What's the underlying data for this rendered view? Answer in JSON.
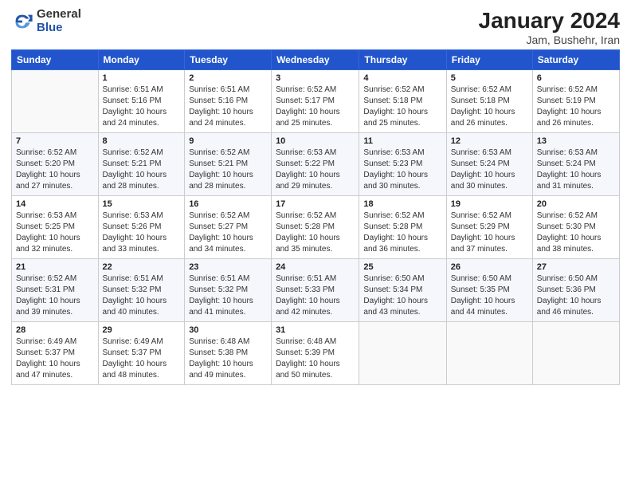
{
  "header": {
    "logo_general": "General",
    "logo_blue": "Blue",
    "title": "January 2024",
    "subtitle": "Jam, Bushehr, Iran"
  },
  "weekdays": [
    "Sunday",
    "Monday",
    "Tuesday",
    "Wednesday",
    "Thursday",
    "Friday",
    "Saturday"
  ],
  "weeks": [
    [
      {
        "day": "",
        "sunrise": "",
        "sunset": "",
        "daylight": ""
      },
      {
        "day": "1",
        "sunrise": "Sunrise: 6:51 AM",
        "sunset": "Sunset: 5:16 PM",
        "daylight": "Daylight: 10 hours and 24 minutes."
      },
      {
        "day": "2",
        "sunrise": "Sunrise: 6:51 AM",
        "sunset": "Sunset: 5:16 PM",
        "daylight": "Daylight: 10 hours and 24 minutes."
      },
      {
        "day": "3",
        "sunrise": "Sunrise: 6:52 AM",
        "sunset": "Sunset: 5:17 PM",
        "daylight": "Daylight: 10 hours and 25 minutes."
      },
      {
        "day": "4",
        "sunrise": "Sunrise: 6:52 AM",
        "sunset": "Sunset: 5:18 PM",
        "daylight": "Daylight: 10 hours and 25 minutes."
      },
      {
        "day": "5",
        "sunrise": "Sunrise: 6:52 AM",
        "sunset": "Sunset: 5:18 PM",
        "daylight": "Daylight: 10 hours and 26 minutes."
      },
      {
        "day": "6",
        "sunrise": "Sunrise: 6:52 AM",
        "sunset": "Sunset: 5:19 PM",
        "daylight": "Daylight: 10 hours and 26 minutes."
      }
    ],
    [
      {
        "day": "7",
        "sunrise": "Sunrise: 6:52 AM",
        "sunset": "Sunset: 5:20 PM",
        "daylight": "Daylight: 10 hours and 27 minutes."
      },
      {
        "day": "8",
        "sunrise": "Sunrise: 6:52 AM",
        "sunset": "Sunset: 5:21 PM",
        "daylight": "Daylight: 10 hours and 28 minutes."
      },
      {
        "day": "9",
        "sunrise": "Sunrise: 6:52 AM",
        "sunset": "Sunset: 5:21 PM",
        "daylight": "Daylight: 10 hours and 28 minutes."
      },
      {
        "day": "10",
        "sunrise": "Sunrise: 6:53 AM",
        "sunset": "Sunset: 5:22 PM",
        "daylight": "Daylight: 10 hours and 29 minutes."
      },
      {
        "day": "11",
        "sunrise": "Sunrise: 6:53 AM",
        "sunset": "Sunset: 5:23 PM",
        "daylight": "Daylight: 10 hours and 30 minutes."
      },
      {
        "day": "12",
        "sunrise": "Sunrise: 6:53 AM",
        "sunset": "Sunset: 5:24 PM",
        "daylight": "Daylight: 10 hours and 30 minutes."
      },
      {
        "day": "13",
        "sunrise": "Sunrise: 6:53 AM",
        "sunset": "Sunset: 5:24 PM",
        "daylight": "Daylight: 10 hours and 31 minutes."
      }
    ],
    [
      {
        "day": "14",
        "sunrise": "Sunrise: 6:53 AM",
        "sunset": "Sunset: 5:25 PM",
        "daylight": "Daylight: 10 hours and 32 minutes."
      },
      {
        "day": "15",
        "sunrise": "Sunrise: 6:53 AM",
        "sunset": "Sunset: 5:26 PM",
        "daylight": "Daylight: 10 hours and 33 minutes."
      },
      {
        "day": "16",
        "sunrise": "Sunrise: 6:52 AM",
        "sunset": "Sunset: 5:27 PM",
        "daylight": "Daylight: 10 hours and 34 minutes."
      },
      {
        "day": "17",
        "sunrise": "Sunrise: 6:52 AM",
        "sunset": "Sunset: 5:28 PM",
        "daylight": "Daylight: 10 hours and 35 minutes."
      },
      {
        "day": "18",
        "sunrise": "Sunrise: 6:52 AM",
        "sunset": "Sunset: 5:28 PM",
        "daylight": "Daylight: 10 hours and 36 minutes."
      },
      {
        "day": "19",
        "sunrise": "Sunrise: 6:52 AM",
        "sunset": "Sunset: 5:29 PM",
        "daylight": "Daylight: 10 hours and 37 minutes."
      },
      {
        "day": "20",
        "sunrise": "Sunrise: 6:52 AM",
        "sunset": "Sunset: 5:30 PM",
        "daylight": "Daylight: 10 hours and 38 minutes."
      }
    ],
    [
      {
        "day": "21",
        "sunrise": "Sunrise: 6:52 AM",
        "sunset": "Sunset: 5:31 PM",
        "daylight": "Daylight: 10 hours and 39 minutes."
      },
      {
        "day": "22",
        "sunrise": "Sunrise: 6:51 AM",
        "sunset": "Sunset: 5:32 PM",
        "daylight": "Daylight: 10 hours and 40 minutes."
      },
      {
        "day": "23",
        "sunrise": "Sunrise: 6:51 AM",
        "sunset": "Sunset: 5:32 PM",
        "daylight": "Daylight: 10 hours and 41 minutes."
      },
      {
        "day": "24",
        "sunrise": "Sunrise: 6:51 AM",
        "sunset": "Sunset: 5:33 PM",
        "daylight": "Daylight: 10 hours and 42 minutes."
      },
      {
        "day": "25",
        "sunrise": "Sunrise: 6:50 AM",
        "sunset": "Sunset: 5:34 PM",
        "daylight": "Daylight: 10 hours and 43 minutes."
      },
      {
        "day": "26",
        "sunrise": "Sunrise: 6:50 AM",
        "sunset": "Sunset: 5:35 PM",
        "daylight": "Daylight: 10 hours and 44 minutes."
      },
      {
        "day": "27",
        "sunrise": "Sunrise: 6:50 AM",
        "sunset": "Sunset: 5:36 PM",
        "daylight": "Daylight: 10 hours and 46 minutes."
      }
    ],
    [
      {
        "day": "28",
        "sunrise": "Sunrise: 6:49 AM",
        "sunset": "Sunset: 5:37 PM",
        "daylight": "Daylight: 10 hours and 47 minutes."
      },
      {
        "day": "29",
        "sunrise": "Sunrise: 6:49 AM",
        "sunset": "Sunset: 5:37 PM",
        "daylight": "Daylight: 10 hours and 48 minutes."
      },
      {
        "day": "30",
        "sunrise": "Sunrise: 6:48 AM",
        "sunset": "Sunset: 5:38 PM",
        "daylight": "Daylight: 10 hours and 49 minutes."
      },
      {
        "day": "31",
        "sunrise": "Sunrise: 6:48 AM",
        "sunset": "Sunset: 5:39 PM",
        "daylight": "Daylight: 10 hours and 50 minutes."
      },
      {
        "day": "",
        "sunrise": "",
        "sunset": "",
        "daylight": ""
      },
      {
        "day": "",
        "sunrise": "",
        "sunset": "",
        "daylight": ""
      },
      {
        "day": "",
        "sunrise": "",
        "sunset": "",
        "daylight": ""
      }
    ]
  ]
}
